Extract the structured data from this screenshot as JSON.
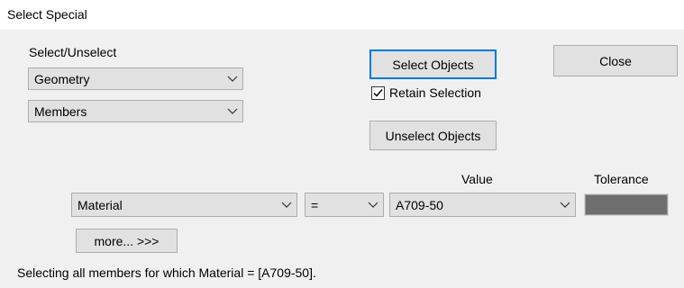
{
  "window": {
    "title": "Select Special"
  },
  "select_group": {
    "label": "Select/Unselect",
    "first_combo": "Geometry",
    "second_combo": "Members"
  },
  "buttons": {
    "select_objects": "Select Objects",
    "unselect_objects": "Unselect Objects",
    "close": "Close",
    "more": "more... >>>"
  },
  "retain_selection": {
    "label": "Retain Selection",
    "checked": true
  },
  "criteria": {
    "value_header": "Value",
    "tolerance_header": "Tolerance",
    "property": "Material",
    "operator": "=",
    "value": "A709-50",
    "tolerance_color": "#6e6e6e"
  },
  "status": "Selecting all members for which Material = [A709-50]."
}
